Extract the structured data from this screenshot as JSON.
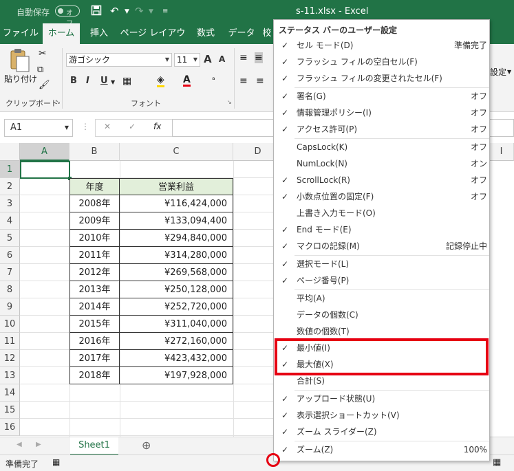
{
  "titlebar": {
    "autosave_label": "自動保存",
    "autosave_state": "オフ",
    "title": "s-11.xlsx  -  Excel"
  },
  "ribbon_tabs": [
    "ファイル",
    "ホーム",
    "挿入",
    "ページ レイアウト",
    "数式",
    "データ",
    "校"
  ],
  "ribbon": {
    "paste_label": "貼り付け",
    "clipboard_group": "クリップボード",
    "font_name": "游ゴシック",
    "font_size": "11",
    "font_group": "フォント",
    "bold": "B",
    "italic": "I",
    "underline": "U",
    "font_color_glyph": "A",
    "settings_label": "設定"
  },
  "formula_bar": {
    "name_box": "A1",
    "cancel": "✕",
    "enter": "✓",
    "fx": "fx"
  },
  "grid": {
    "columns": [
      "A",
      "B",
      "C",
      "D",
      "I"
    ],
    "rows": [
      "1",
      "2",
      "3",
      "4",
      "5",
      "6",
      "7",
      "8",
      "9",
      "10",
      "11",
      "12",
      "13",
      "14",
      "15",
      "16"
    ],
    "table": {
      "header_year": "年度",
      "header_value": "営業利益",
      "years": [
        "2008年",
        "2009年",
        "2010年",
        "2011年",
        "2012年",
        "2013年",
        "2014年",
        "2015年",
        "2016年",
        "2017年",
        "2018年"
      ],
      "values": [
        "¥116,424,000",
        "¥133,094,400",
        "¥294,840,000",
        "¥314,280,000",
        "¥269,568,000",
        "¥250,128,000",
        "¥252,720,000",
        "¥311,040,000",
        "¥272,160,000",
        "¥423,432,000",
        "¥197,928,000"
      ]
    }
  },
  "sheet_tabs": {
    "active": "Sheet1",
    "add": "⊕"
  },
  "status_bar": {
    "ready": "準備完了"
  },
  "menu": {
    "title": "ステータス バーのユーザー設定",
    "items": [
      {
        "label": "セル モード(D)",
        "value": "準備完了",
        "checked": true
      },
      {
        "label": "フラッシュ フィルの空白セル(F)",
        "value": "",
        "checked": true
      },
      {
        "label": "フラッシュ フィルの変更されたセル(F)",
        "value": "",
        "checked": true
      },
      {
        "label": "署名(G)",
        "value": "オフ",
        "checked": true
      },
      {
        "label": "情報管理ポリシー(I)",
        "value": "オフ",
        "checked": true
      },
      {
        "label": "アクセス許可(P)",
        "value": "オフ",
        "checked": true
      },
      {
        "label": "CapsLock(K)",
        "value": "オフ",
        "checked": false
      },
      {
        "label": "NumLock(N)",
        "value": "オン",
        "checked": false
      },
      {
        "label": "ScrollLock(R)",
        "value": "オフ",
        "checked": true
      },
      {
        "label": "小数点位置の固定(F)",
        "value": "オフ",
        "checked": true
      },
      {
        "label": "上書き入力モード(O)",
        "value": "",
        "checked": false
      },
      {
        "label": "End モード(E)",
        "value": "",
        "checked": true
      },
      {
        "label": "マクロの記録(M)",
        "value": "記録停止中",
        "checked": true
      },
      {
        "label": "選択モード(L)",
        "value": "",
        "checked": true
      },
      {
        "label": "ページ番号(P)",
        "value": "",
        "checked": true
      },
      {
        "label": "平均(A)",
        "value": "",
        "checked": false
      },
      {
        "label": "データの個数(C)",
        "value": "",
        "checked": false
      },
      {
        "label": "数値の個数(T)",
        "value": "",
        "checked": false
      },
      {
        "label": "最小値(I)",
        "value": "",
        "checked": true
      },
      {
        "label": "最大値(X)",
        "value": "",
        "checked": true
      },
      {
        "label": "合計(S)",
        "value": "",
        "checked": false
      },
      {
        "label": "アップロード状態(U)",
        "value": "",
        "checked": true
      },
      {
        "label": "表示選択ショートカット(V)",
        "value": "",
        "checked": true
      },
      {
        "label": "ズーム スライダー(Z)",
        "value": "",
        "checked": true
      },
      {
        "label": "ズーム(Z)",
        "value": "100%",
        "checked": true
      }
    ]
  },
  "colors": {
    "excel_green": "#217346",
    "highlight_red": "#e60012",
    "table_header_fill": "#e2efda"
  }
}
